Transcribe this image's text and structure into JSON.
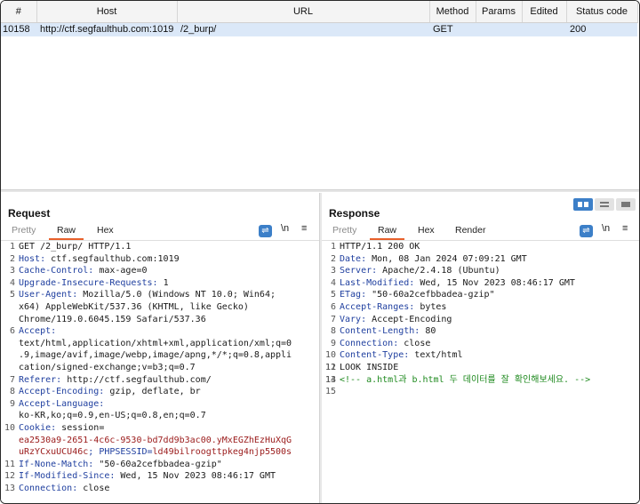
{
  "history": {
    "columns": [
      "#",
      "Host",
      "URL",
      "Method",
      "Params",
      "Edited",
      "Status code"
    ],
    "row": {
      "num": "10158",
      "host": "http://ctf.segfaulthub.com:1019",
      "url": "/2_burp/",
      "method": "GET",
      "params": "",
      "edited": "",
      "status": "200"
    }
  },
  "request": {
    "title": "Request",
    "tabs": [
      "Pretty",
      "Raw",
      "Hex"
    ],
    "active_tab": "Raw",
    "tools": {
      "wrap": "⇌",
      "newline": "\\n",
      "menu": "≡"
    },
    "lines": [
      {
        "n": "1",
        "k": "",
        "v": "GET /2_burp/ HTTP/1.1"
      },
      {
        "n": "2",
        "k": "Host:",
        "v": " ctf.segfaulthub.com:1019"
      },
      {
        "n": "3",
        "k": "Cache-Control:",
        "v": " max-age=0"
      },
      {
        "n": "4",
        "k": "Upgrade-Insecure-Requests:",
        "v": " 1"
      },
      {
        "n": "5",
        "k": "User-Agent:",
        "v": " Mozilla/5.0 (Windows NT 10.0; Win64;",
        "cont": [
          "x64) AppleWebKit/537.36 (KHTML, like Gecko)",
          "Chrome/119.0.6045.159 Safari/537.36"
        ]
      },
      {
        "n": "6",
        "k": "Accept:",
        "v": "",
        "cont": [
          "text/html,application/xhtml+xml,application/xml;q=0",
          ".9,image/avif,image/webp,image/apng,*/*;q=0.8,appli",
          "cation/signed-exchange;v=b3;q=0.7"
        ]
      },
      {
        "n": "7",
        "k": "Referer:",
        "v": " http://ctf.segfaulthub.com/"
      },
      {
        "n": "8",
        "k": "Accept-Encoding:",
        "v": " gzip, deflate, br"
      },
      {
        "n": "9",
        "k": "Accept-Language:",
        "v": "",
        "cont": [
          "ko-KR,ko;q=0.9,en-US;q=0.8,en;q=0.7"
        ]
      },
      {
        "n": "10",
        "k": "Cookie:",
        "v": " session=",
        "cookie": true,
        "cookie_lines": [
          "ea2530a9-2651-4c6c-9530-bd7dd9b3ac00.yMxEGZhEzHuXqG",
          "uRzYCxuUCU46c"
        ],
        "cookie_tail_key": "; PHPSESSID=",
        "cookie_tail_val": "ld49bilroogttpkeg4njp5500s"
      },
      {
        "n": "11",
        "k": "If-None-Match:",
        "v": " \"50-60a2cefbbadea-gzip\""
      },
      {
        "n": "12",
        "k": "If-Modified-Since:",
        "v": " Wed, 15 Nov 2023 08:46:17 GMT"
      },
      {
        "n": "13",
        "k": "Connection:",
        "v": " close"
      }
    ]
  },
  "response": {
    "title": "Response",
    "tabs": [
      "Pretty",
      "Raw",
      "Hex",
      "Render"
    ],
    "active_tab": "Raw",
    "tools": {
      "wrap": "⇌",
      "newline": "\\n",
      "menu": "≡"
    },
    "lines": [
      {
        "n": "1",
        "k": "",
        "v": "HTTP/1.1 200 OK"
      },
      {
        "n": "2",
        "k": "Date:",
        "v": " Mon, 08 Jan 2024 07:09:21 GMT"
      },
      {
        "n": "3",
        "k": "Server:",
        "v": " Apache/2.4.18 (Ubuntu)"
      },
      {
        "n": "4",
        "k": "Last-Modified:",
        "v": " Wed, 15 Nov 2023 08:46:17 GMT"
      },
      {
        "n": "5",
        "k": "ETag:",
        "v": " \"50-60a2cefbbadea-gzip\""
      },
      {
        "n": "6",
        "k": "Accept-Ranges:",
        "v": " bytes"
      },
      {
        "n": "7",
        "k": "Vary:",
        "v": " Accept-Encoding"
      },
      {
        "n": "8",
        "k": "Content-Length:",
        "v": " 80"
      },
      {
        "n": "9",
        "k": "Connection:",
        "v": " close"
      },
      {
        "n": "10",
        "k": "Content-Type:",
        "v": " text/html"
      },
      {
        "n": "11",
        "k": "",
        "v": ""
      },
      {
        "n": "12",
        "k": "",
        "v": "LOOK INSIDE"
      },
      {
        "n": "13",
        "k": "",
        "v": ""
      },
      {
        "n": "14",
        "k": "",
        "v": "",
        "comment": "<!-- a.html과 b.html 두 데이터를 잘 확인해보세요. -->"
      },
      {
        "n": "15",
        "k": "",
        "v": ""
      }
    ]
  },
  "colors": {
    "accent_tab": "#e8612c",
    "selected_row": "#dbe8f8",
    "header_key": "#1f3f9f",
    "cookie_value": "#9a1a1a",
    "comment": "#1f8a1f",
    "toggle_blue": "#3c7fc8"
  },
  "icons": {
    "layout": [
      "split-horizontal-icon",
      "split-vertical-icon",
      "tabs-icon"
    ]
  }
}
